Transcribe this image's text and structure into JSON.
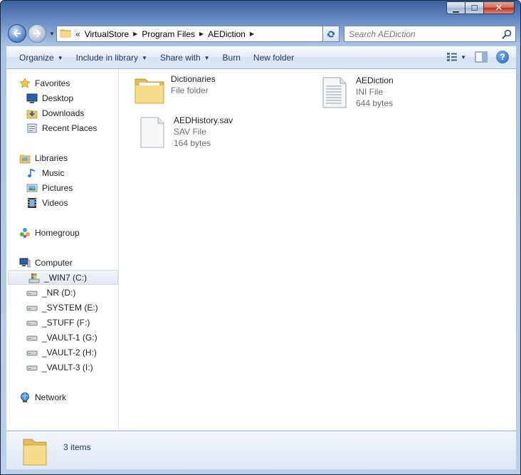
{
  "window": {
    "caption_buttons": {
      "minimize": "▁",
      "maximize": "☐",
      "close": "✕"
    }
  },
  "nav": {
    "crumbs": [
      "VirtualStore",
      "Program Files",
      "AEDiction"
    ],
    "overflow": "«",
    "search_placeholder": "Search AEDiction"
  },
  "toolbar": {
    "organize": "Organize",
    "include_in_library": "Include in library",
    "share_with": "Share with",
    "burn": "Burn",
    "new_folder": "New folder",
    "help": "?"
  },
  "sidebar": {
    "items": [
      {
        "label": "Favorites",
        "icon": "star-icon"
      },
      {
        "label": "Desktop",
        "icon": "desktop-icon"
      },
      {
        "label": "Downloads",
        "icon": "downloads-icon"
      },
      {
        "label": "Recent Places",
        "icon": "recent-places-icon"
      },
      {
        "label": "Libraries",
        "icon": "libraries-icon"
      },
      {
        "label": "Music",
        "icon": "music-icon"
      },
      {
        "label": "Pictures",
        "icon": "pictures-icon"
      },
      {
        "label": "Videos",
        "icon": "videos-icon"
      },
      {
        "label": "Homegroup",
        "icon": "homegroup-icon"
      },
      {
        "label": "Computer",
        "icon": "computer-icon"
      },
      {
        "label": "_WIN7 (C:)",
        "icon": "windows-drive-icon"
      },
      {
        "label": "_NR (D:)",
        "icon": "drive-icon"
      },
      {
        "label": "_SYSTEM (E:)",
        "icon": "drive-icon"
      },
      {
        "label": "_STUFF (F:)",
        "icon": "drive-icon"
      },
      {
        "label": "_VAULT-1 (G:)",
        "icon": "drive-icon"
      },
      {
        "label": "_VAULT-2 (H:)",
        "icon": "drive-icon"
      },
      {
        "label": "_VAULT-3 (I:)",
        "icon": "drive-icon"
      },
      {
        "label": "Network",
        "icon": "network-icon"
      }
    ]
  },
  "files": [
    {
      "name": "Dictionaries",
      "type": "File folder",
      "size": "",
      "icon": "folder-icon"
    },
    {
      "name": "AEDiction",
      "type": "INI File",
      "size": "644 bytes",
      "icon": "ini-file-icon"
    },
    {
      "name": "AEDHistory.sav",
      "type": "SAV File",
      "size": "164 bytes",
      "icon": "blank-file-icon"
    }
  ],
  "status": {
    "count": "3 items"
  },
  "colors": {
    "accent": "#1e395b",
    "selection": "#e1e8f1"
  }
}
